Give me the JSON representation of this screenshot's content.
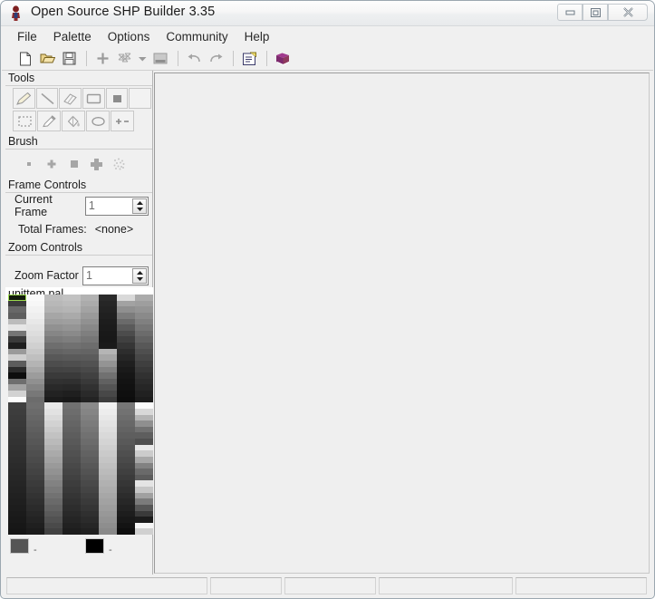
{
  "window": {
    "title": "Open Source SHP Builder 3.35",
    "icon": "unit-figure-icon",
    "controls": {
      "minimize_label": "Minimize",
      "maximize_label": "Maximize",
      "close_label": "Close"
    }
  },
  "menu": {
    "items": [
      {
        "label": "File"
      },
      {
        "label": "Palette"
      },
      {
        "label": "Options"
      },
      {
        "label": "Community"
      },
      {
        "label": "Help"
      }
    ]
  },
  "toolbar": {
    "buttons": [
      {
        "name": "new-file-icon",
        "tooltip": "New",
        "enabled": true
      },
      {
        "name": "open-folder-icon",
        "tooltip": "Open",
        "enabled": true
      },
      {
        "name": "save-disk-icon",
        "tooltip": "Save",
        "enabled": true
      },
      {
        "name": "add-frame-icon",
        "tooltip": "Add Frame",
        "enabled": false
      },
      {
        "name": "frames-icon",
        "tooltip": "Frames",
        "enabled": false
      },
      {
        "name": "chevron-down-icon",
        "tooltip": "More",
        "enabled": false
      },
      {
        "name": "image-icon",
        "tooltip": "Image",
        "enabled": false
      },
      {
        "name": "undo-icon",
        "tooltip": "Undo",
        "enabled": false
      },
      {
        "name": "redo-icon",
        "tooltip": "Redo",
        "enabled": false
      },
      {
        "name": "properties-icon",
        "tooltip": "Properties",
        "enabled": true
      },
      {
        "name": "book-icon",
        "tooltip": "Help Book",
        "enabled": true
      }
    ]
  },
  "tools_panel": {
    "title": "Tools",
    "row1": [
      {
        "name": "pencil-tool",
        "label": "Pencil"
      },
      {
        "name": "line-tool",
        "label": "Line"
      },
      {
        "name": "eraser-tool",
        "label": "Eraser"
      },
      {
        "name": "rectangle-tool",
        "label": "Rectangle"
      },
      {
        "name": "filled-rect-tool",
        "label": "Filled Rectangle"
      },
      {
        "name": "blank-tool",
        "label": ""
      }
    ],
    "row2": [
      {
        "name": "select-marquee-tool",
        "label": "Select"
      },
      {
        "name": "eyedropper-tool",
        "label": "Pick Color"
      },
      {
        "name": "fill-bucket-tool",
        "label": "Fill"
      },
      {
        "name": "ellipse-tool",
        "label": "Ellipse"
      },
      {
        "name": "plusminus-tool",
        "label": "Shift Colors"
      }
    ]
  },
  "brush_panel": {
    "title": "Brush",
    "sizes": [
      {
        "name": "brush-size-1",
        "label": "1 px"
      },
      {
        "name": "brush-size-plus",
        "label": "Small Cross"
      },
      {
        "name": "brush-size-3",
        "label": "3 px"
      },
      {
        "name": "brush-size-big",
        "label": "Large Cross"
      },
      {
        "name": "brush-spray",
        "label": "Spray"
      }
    ]
  },
  "frame_controls": {
    "title": "Frame Controls",
    "current_frame_label": "Current Frame",
    "current_frame_value": "1",
    "total_frames_label": "Total Frames:",
    "total_frames_value": "<none>"
  },
  "zoom_controls": {
    "title": "Zoom Controls",
    "zoom_factor_label": "Zoom Factor",
    "zoom_factor_value": "1"
  },
  "palette": {
    "filename": "unittem.pal",
    "selected_index": 0,
    "primary_color": "#555555",
    "secondary_color": "#000000",
    "primary_dot": "-",
    "secondary_dot": "-",
    "columns": 8,
    "colors": [
      "#121a0c",
      "#fafafa",
      "#bdbdbd",
      "#c2c2c2",
      "#b2b2b2",
      "#2a2a2a",
      "#d9d9d9",
      "#ababab",
      "#3b3b3b",
      "#f7f7f7",
      "#b8b8b8",
      "#bcbcbc",
      "#ababab",
      "#262626",
      "#a2a2a2",
      "#9e9e9e",
      "#686868",
      "#f2f2f2",
      "#b2b2b2",
      "#b5b5b5",
      "#a3a3a3",
      "#232323",
      "#8f8f8f",
      "#949494",
      "#5e5e5e",
      "#eeeeee",
      "#a6a6a6",
      "#aaaaaa",
      "#9a9a9a",
      "#202020",
      "#7c7c7c",
      "#8a8a8a",
      "#bcbcbc",
      "#e8e8e8",
      "#9d9d9d",
      "#9f9f9f",
      "#919191",
      "#1d1d1d",
      "#6a6a6a",
      "#808080",
      "#e6e6e6",
      "#e2e2e2",
      "#919191",
      "#959595",
      "#888888",
      "#1b1b1b",
      "#5a5a5a",
      "#767676",
      "#767676",
      "#dddddd",
      "#868686",
      "#8a8a8a",
      "#7f7f7f",
      "#191919",
      "#4c4c4c",
      "#6c6c6c",
      "#3a3a3a",
      "#d7d7d7",
      "#7a7a7a",
      "#7e7e7e",
      "#767676",
      "#181818",
      "#404040",
      "#626262",
      "#1e1e1e",
      "#d0d0d0",
      "#6e6e6e",
      "#717171",
      "#6d6d6d",
      "#1a1a1a",
      "#363636",
      "#585858",
      "#9a9a9a",
      "#c8c8c8",
      "#636363",
      "#666666",
      "#646464",
      "#b5b5b5",
      "#2d2d2d",
      "#4f4f4f",
      "#cfcfcf",
      "#bfbfbf",
      "#585858",
      "#5a5a5a",
      "#5b5b5b",
      "#a6a6a6",
      "#262626",
      "#474747",
      "#5d5d5d",
      "#b4b4b4",
      "#4d4d4d",
      "#4f4f4f",
      "#525252",
      "#949494",
      "#1f1f1f",
      "#3f3f3f",
      "#2b2b2b",
      "#a8a8a8",
      "#434343",
      "#444444",
      "#494949",
      "#828282",
      "#1a1a1a",
      "#383838",
      "#0d0d0d",
      "#9c9c9c",
      "#3a3a3a",
      "#3a3a3a",
      "#414141",
      "#717171",
      "#161616",
      "#313131",
      "#6e6e6e",
      "#909090",
      "#313131",
      "#303030",
      "#393939",
      "#616161",
      "#131313",
      "#2b2b2b",
      "#a3a3a3",
      "#848484",
      "#292929",
      "#272727",
      "#313131",
      "#545454",
      "#111111",
      "#262626",
      "#d2d2d2",
      "#787878",
      "#222222",
      "#1f1f1f",
      "#2a2a2a",
      "#484848",
      "#0f0f0f",
      "#212121",
      "#fcfcfc",
      "#6c6c6c",
      "#1b1b1b",
      "#181818",
      "#232323",
      "#3d3d3d",
      "#0d0d0d",
      "#1c1c1c",
      "#3f3f3f",
      "#6f6f6f",
      "#e9e9e9",
      "#717171",
      "#8a8a8a",
      "#f2f2f2",
      "#777777",
      "#fbfbfb",
      "#3d3d3d",
      "#6b6b6b",
      "#e2e2e2",
      "#6d6d6d",
      "#858585",
      "#ededed",
      "#727272",
      "#d8d8d8",
      "#3b3b3b",
      "#676767",
      "#dadada",
      "#696969",
      "#808080",
      "#e8e8e8",
      "#6d6d6d",
      "#b4b4b4",
      "#393939",
      "#636363",
      "#d2d2d2",
      "#656565",
      "#7b7b7b",
      "#e3e3e3",
      "#686868",
      "#8f8f8f",
      "#373737",
      "#5f5f5f",
      "#cacaca",
      "#616161",
      "#767676",
      "#dedede",
      "#636363",
      "#717171",
      "#353535",
      "#5b5b5b",
      "#c2c2c2",
      "#5d5d5d",
      "#717171",
      "#d9d9d9",
      "#5e5e5e",
      "#5e5e5e",
      "#333333",
      "#575757",
      "#bababa",
      "#595959",
      "#6c6c6c",
      "#d4d4d4",
      "#595959",
      "#4f4f4f",
      "#313131",
      "#535353",
      "#b2b2b2",
      "#555555",
      "#676767",
      "#cfcfcf",
      "#545454",
      "#e9e9e9",
      "#2f2f2f",
      "#4f4f4f",
      "#aaaaaa",
      "#515151",
      "#626262",
      "#cacaca",
      "#4f4f4f",
      "#cccccc",
      "#2d2d2d",
      "#4b4b4b",
      "#a2a2a2",
      "#4d4d4d",
      "#5d5d5d",
      "#c5c5c5",
      "#4a4a4a",
      "#a8a8a8",
      "#2b2b2b",
      "#474747",
      "#9a9a9a",
      "#494949",
      "#585858",
      "#c0c0c0",
      "#454545",
      "#828282",
      "#292929",
      "#434343",
      "#929292",
      "#454545",
      "#535353",
      "#bbbbbb",
      "#404040",
      "#6a6a6a",
      "#272727",
      "#3f3f3f",
      "#8a8a8a",
      "#414141",
      "#4e4e4e",
      "#b6b6b6",
      "#3b3b3b",
      "#5c5c5c",
      "#252525",
      "#3b3b3b",
      "#828282",
      "#3d3d3d",
      "#494949",
      "#b1b1b1",
      "#363636",
      "#e4e4e4",
      "#232323",
      "#373737",
      "#7a7a7a",
      "#393939",
      "#444444",
      "#acacac",
      "#313131",
      "#c6c6c6",
      "#212121",
      "#333333",
      "#727272",
      "#353535",
      "#3f3f3f",
      "#a7a7a7",
      "#2c2c2c",
      "#a0a0a0",
      "#1f1f1f",
      "#2f2f2f",
      "#6a6a6a",
      "#313131",
      "#3a3a3a",
      "#a2a2a2",
      "#272727",
      "#7b7b7b",
      "#1d1d1d",
      "#2b2b2b",
      "#626262",
      "#2d2d2d",
      "#353535",
      "#9d9d9d",
      "#222222",
      "#565656",
      "#1b1b1b",
      "#272727",
      "#5a5a5a",
      "#292929",
      "#303030",
      "#989898",
      "#1d1d1d",
      "#3a3a3a",
      "#191919",
      "#232323",
      "#525252",
      "#252525",
      "#2b2b2b",
      "#939393",
      "#181818",
      "#1b1b1b",
      "#171717",
      "#1f1f1f",
      "#4a4a4a",
      "#212121",
      "#262626",
      "#8e8e8e",
      "#131313",
      "#f6f6f6",
      "#151515",
      "#1b1b1b",
      "#424242",
      "#1d1d1d",
      "#212121",
      "#898989",
      "#0e0e0e",
      "#d0d0d0"
    ]
  },
  "canvas": {
    "name": "drawing-canvas",
    "background": "#efefef"
  },
  "status_bar": {
    "panels": [
      "",
      "",
      "",
      "",
      ""
    ]
  }
}
